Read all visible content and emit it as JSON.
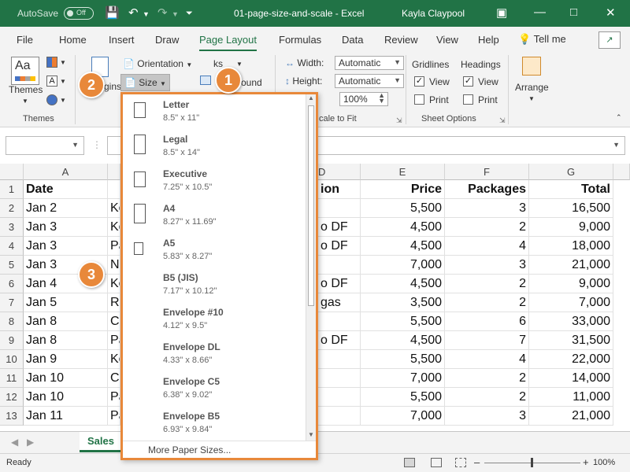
{
  "titlebar": {
    "autosave_label": "AutoSave",
    "autosave_state": "Off",
    "document_title": "01-page-size-and-scale  -  Excel",
    "user_name": "Kayla Claypool"
  },
  "tabs": [
    "File",
    "Home",
    "Insert",
    "Draw",
    "Page Layout",
    "Formulas",
    "Data",
    "Review",
    "View",
    "Help"
  ],
  "active_tab": "Page Layout",
  "tell_me": "Tell me",
  "ribbon": {
    "themes_label": "Themes",
    "themes_group": "Themes",
    "orientation_label": "Orientation",
    "size_label": "Size",
    "margins_label_fragment": "rgins",
    "breaks_label_fragment": "ks",
    "background_label_fragment": "ound",
    "width_label": "Width:",
    "width_value": "Automatic",
    "height_label": "Height:",
    "height_value": "Automatic",
    "scale_value": "100%",
    "scale_group_fragment": "cale to Fit",
    "gridlines_label": "Gridlines",
    "headings_label": "Headings",
    "view_label": "View",
    "print_label": "Print",
    "gridlines_view_checked": true,
    "gridlines_print_checked": false,
    "headings_view_checked": true,
    "headings_print_checked": false,
    "sheet_options_group": "Sheet Options",
    "arrange_label": "Arrange"
  },
  "columns": [
    "A",
    "D",
    "E",
    "F",
    "G"
  ],
  "rows": [
    {
      "n": "1",
      "a": "Date",
      "b": "",
      "d": "ion",
      "e": "Price",
      "f": "Packages",
      "g": "Total"
    },
    {
      "n": "2",
      "a": "Jan 2",
      "b": "Ke",
      "d": "",
      "e": "5,500",
      "f": "3",
      "g": "16,500"
    },
    {
      "n": "3",
      "a": "Jan 3",
      "b": "Ke",
      "d": "o DF",
      "e": "4,500",
      "f": "2",
      "g": "9,000"
    },
    {
      "n": "4",
      "a": "Jan 3",
      "b": "Pa",
      "d": "o DF",
      "e": "4,500",
      "f": "4",
      "g": "18,000"
    },
    {
      "n": "5",
      "a": "Jan 3",
      "b": "N",
      "d": "",
      "e": "7,000",
      "f": "3",
      "g": "21,000"
    },
    {
      "n": "6",
      "a": "Jan 4",
      "b": "Ke",
      "d": "o DF",
      "e": "4,500",
      "f": "2",
      "g": "9,000"
    },
    {
      "n": "7",
      "a": "Jan 5",
      "b": "Ro",
      "d": "gas",
      "e": "3,500",
      "f": "2",
      "g": "7,000"
    },
    {
      "n": "8",
      "a": "Jan 8",
      "b": "Ca",
      "d": "",
      "e": "5,500",
      "f": "6",
      "g": "33,000"
    },
    {
      "n": "9",
      "a": "Jan 8",
      "b": "Pa",
      "d": "o DF",
      "e": "4,500",
      "f": "7",
      "g": "31,500"
    },
    {
      "n": "10",
      "a": "Jan 9",
      "b": "Ke",
      "d": "",
      "e": "5,500",
      "f": "4",
      "g": "22,000"
    },
    {
      "n": "11",
      "a": "Jan 10",
      "b": "Ca",
      "d": "",
      "e": "7,000",
      "f": "2",
      "g": "14,000"
    },
    {
      "n": "12",
      "a": "Jan 10",
      "b": "Pa",
      "d": "",
      "e": "5,500",
      "f": "2",
      "g": "11,000"
    },
    {
      "n": "13",
      "a": "Jan 11",
      "b": "Pa",
      "d": "",
      "e": "7,000",
      "f": "3",
      "g": "21,000"
    }
  ],
  "size_menu": {
    "items": [
      {
        "name": "Letter",
        "dims": "8.5\" x 11\"",
        "shape": "portrait"
      },
      {
        "name": "Legal",
        "dims": "8.5\" x 14\"",
        "shape": "tall"
      },
      {
        "name": "Executive",
        "dims": "7.25\" x 10.5\"",
        "shape": "portrait"
      },
      {
        "name": "A4",
        "dims": "8.27\" x 11.69\"",
        "shape": "tall"
      },
      {
        "name": "A5",
        "dims": "5.83\" x 8.27\"",
        "shape": "small"
      },
      {
        "name": "B5 (JIS)",
        "dims": "7.17\" x 10.12\"",
        "shape": "none"
      },
      {
        "name": "Envelope #10",
        "dims": "4.12\" x 9.5\"",
        "shape": "none"
      },
      {
        "name": "Envelope DL",
        "dims": "4.33\" x 8.66\"",
        "shape": "none"
      },
      {
        "name": "Envelope C5",
        "dims": "6.38\" x 9.02\"",
        "shape": "none"
      },
      {
        "name": "Envelope B5",
        "dims": "6.93\" x 9.84\"",
        "shape": "none"
      }
    ],
    "more_label": "More Paper Sizes..."
  },
  "sheet_tab": "Sales",
  "status": {
    "ready": "Ready",
    "zoom": "100%"
  },
  "callouts": [
    "1",
    "2",
    "3"
  ],
  "colors": {
    "accent": "#217346",
    "callout": "#e8883a"
  }
}
